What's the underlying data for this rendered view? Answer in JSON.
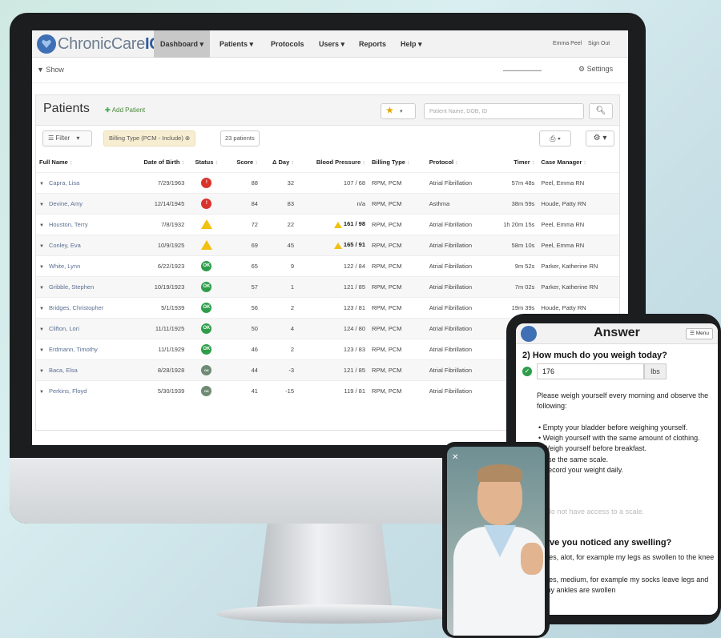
{
  "app": {
    "logo_text_1": "ChronicCare",
    "logo_text_2": "IQ",
    "nav": [
      "Dashboard ▾",
      "Patients ▾",
      "Protocols",
      "Users ▾",
      "Reports",
      "Help ▾"
    ],
    "user": "Emma Peel",
    "signout": "Sign Out",
    "show_label": "▼ Show",
    "settings_label": "Settings"
  },
  "panel": {
    "title": "Patients",
    "add_patient": "Add Patient",
    "search_placeholder": "Patient Name, DOB, ID",
    "filter_label": "Filter",
    "filter_chip": "Billing Type (PCM - Include) ⊗",
    "patient_count": "23 patients"
  },
  "table": {
    "headers": [
      "Full Name",
      "Date of Birth",
      "Status",
      "Score",
      "Δ Day",
      "Blood Pressure",
      "Billing Type",
      "Protocol",
      "Timer",
      "Case Manager"
    ],
    "rows": [
      {
        "name": "Capra, Lisa",
        "dob": "7/29/1963",
        "status": "red",
        "score": "88",
        "day": "32",
        "bp": "107 / 68",
        "bpwarn": false,
        "billing": "RPM, PCM",
        "protocol": "Atrial Fibrillation",
        "timer": "57m 48s",
        "manager": "Peel, Emma RN"
      },
      {
        "name": "Devine, Amy",
        "dob": "12/14/1945",
        "status": "red",
        "score": "84",
        "day": "83",
        "bp": "n/a",
        "bpwarn": false,
        "billing": "RPM, PCM",
        "protocol": "Asthma",
        "timer": "38m 59s",
        "manager": "Houde, Patty RN"
      },
      {
        "name": "Houston, Terry",
        "dob": "7/8/1932",
        "status": "warn",
        "score": "72",
        "day": "22",
        "bp": "161 / 98",
        "bpwarn": true,
        "billing": "RPM, PCM",
        "protocol": "Atrial Fibrillation",
        "timer": "1h 20m 15s",
        "manager": "Peel, Emma RN"
      },
      {
        "name": "Conley, Eva",
        "dob": "10/9/1925",
        "status": "warn",
        "score": "69",
        "day": "45",
        "bp": "165 / 91",
        "bpwarn": true,
        "billing": "RPM, PCM",
        "protocol": "Atrial Fibrillation",
        "timer": "58m 10s",
        "manager": "Peel, Emma RN"
      },
      {
        "name": "White, Lynn",
        "dob": "6/22/1923",
        "status": "green",
        "score": "65",
        "day": "9",
        "bp": "122 / 84",
        "bpwarn": false,
        "billing": "RPM, PCM",
        "protocol": "Atrial Fibrillation",
        "timer": "9m 52s",
        "manager": "Parker, Katherine RN"
      },
      {
        "name": "Gribble, Stephen",
        "dob": "10/19/1923",
        "status": "green",
        "score": "57",
        "day": "1",
        "bp": "121 / 85",
        "bpwarn": false,
        "billing": "RPM, PCM",
        "protocol": "Atrial Fibrillation",
        "timer": "7m 02s",
        "manager": "Parker, Katherine RN"
      },
      {
        "name": "Bridges, Christopher",
        "dob": "5/1/1939",
        "status": "green",
        "score": "56",
        "day": "2",
        "bp": "123 / 81",
        "bpwarn": false,
        "billing": "RPM, PCM",
        "protocol": "Atrial Fibrillation",
        "timer": "19m 39s",
        "manager": "Houde, Patty RN"
      },
      {
        "name": "Clifton, Lori",
        "dob": "11/11/1925",
        "status": "green",
        "score": "50",
        "day": "4",
        "bp": "124 / 80",
        "bpwarn": false,
        "billing": "RPM, PCM",
        "protocol": "Atrial Fibrillation",
        "timer": "",
        "manager": ""
      },
      {
        "name": "Erdmann, Timothy",
        "dob": "11/1/1929",
        "status": "green",
        "score": "46",
        "day": "2",
        "bp": "123 / 83",
        "bpwarn": false,
        "billing": "RPM, PCM",
        "protocol": "Atrial Fibrillation",
        "timer": "",
        "manager": ""
      },
      {
        "name": "Baca, Elsa",
        "dob": "8/28/1928",
        "status": "grey",
        "score": "44",
        "day": "-3",
        "bp": "121 / 85",
        "bpwarn": false,
        "billing": "RPM, PCM",
        "protocol": "Atrial Fibrillation",
        "timer": "",
        "manager": ""
      },
      {
        "name": "Perkins, Floyd",
        "dob": "5/30/1939",
        "status": "grey",
        "score": "41",
        "day": "-15",
        "bp": "119 / 81",
        "bpwarn": false,
        "billing": "RPM, PCM",
        "protocol": "Atrial Fibrillation",
        "timer": "",
        "manager": ""
      }
    ],
    "status_text": {
      "red": "!",
      "green": "OK",
      "grey": "OK",
      "warn": ""
    }
  },
  "tablet": {
    "title": "Answer",
    "menu": "☰ Menu",
    "question": "2) How much do you weigh today?",
    "answer": "176",
    "unit": "lbs",
    "instructions": "Please weigh yourself every morning and observe the following:",
    "bullets": [
      "• Empty your bladder before weighing yourself.",
      "• Weigh yourself with the same amount of clothing.",
      "• Weigh yourself before breakfast.",
      "• Use the same scale.",
      "• Record your weight daily."
    ],
    "no_access": "I do not have access to a scale.",
    "question2": "Have you noticed any swelling?",
    "options": [
      "Yes, alot, for example my legs as swollen to the knee",
      "Yes, medium, for example my socks leave legs and my ankles are swollen"
    ]
  },
  "phone": {
    "close": "✕"
  }
}
